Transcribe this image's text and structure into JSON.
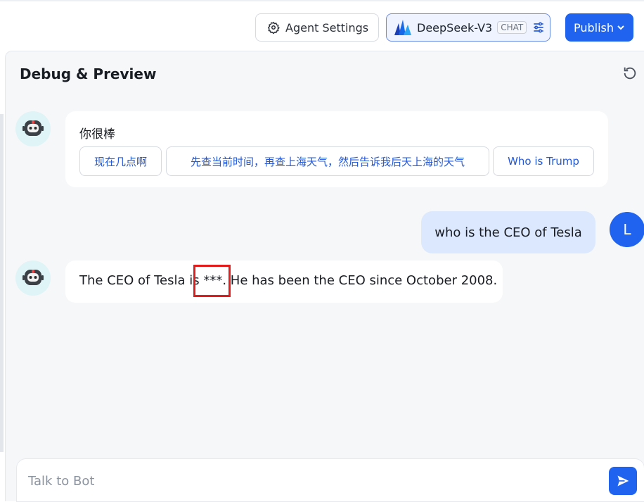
{
  "toolbar": {
    "agent_settings_label": "Agent Settings",
    "model_name": "DeepSeek-V3",
    "model_badge": "CHAT",
    "publish_label": "Publish"
  },
  "panel": {
    "title": "Debug & Preview"
  },
  "messages": {
    "greeting": "你很棒",
    "suggestions": [
      "现在几点啊",
      "先查当前时间，再查上海天气，然后告诉我后天上海的天气",
      "Who is Trump"
    ],
    "user_question": "who is the CEO of Tesla",
    "user_avatar_letter": "L",
    "bot_answer": "The CEO of Tesla is ***. He has been the CEO since October 2008."
  },
  "composer": {
    "placeholder": "Talk to Bot"
  },
  "colors": {
    "accent": "#1f63ef",
    "highlight": "#e21b1b"
  }
}
